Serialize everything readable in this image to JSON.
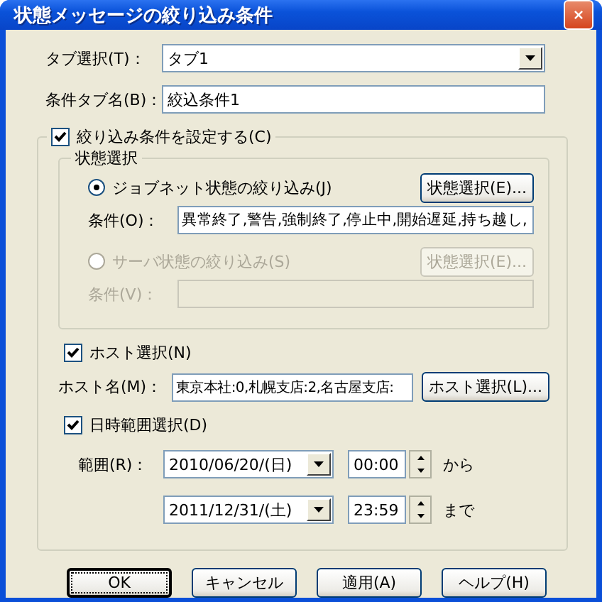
{
  "window": {
    "title": "状態メッセージの絞り込み条件"
  },
  "tab_select": {
    "label": "タブ選択(T)：",
    "value": "タブ1"
  },
  "condition_tab_name": {
    "label": "条件タブ名(B)：",
    "value": "絞込条件1"
  },
  "filter": {
    "label": "絞り込み条件を設定する(C)",
    "checked": true,
    "status_group": {
      "title": "状態選択",
      "options": [
        {
          "label": "ジョブネット状態の絞り込み(J)",
          "selected": true,
          "disabled": false,
          "button": "状態選択(E)...",
          "condition_label": "条件(O)：",
          "condition_value": "異常終了,警告,強制終了,停止中,開始遅延,持ち越し,"
        },
        {
          "label": "サーバ状態の絞り込み(S)",
          "selected": false,
          "disabled": true,
          "button": "状態選択(E)...",
          "condition_label": "条件(V)："
        }
      ]
    },
    "host": {
      "label": "ホスト選択(N)",
      "checked": true,
      "name_label": "ホスト名(M)：",
      "value": "東京本社:0,札幌支店:2,名古屋支店:",
      "button": "ホスト選択(L)..."
    },
    "date_range": {
      "label": "日時範囲選択(D)",
      "checked": true,
      "range_label": "範囲(R)：",
      "rows": [
        {
          "date": "2010/06/20/(日)",
          "time": "00:00",
          "suffix": "から"
        },
        {
          "date": "2011/12/31/(土)",
          "time": "23:59",
          "suffix": "まで"
        }
      ]
    }
  },
  "buttons": [
    {
      "label": "OK",
      "focused": true
    },
    {
      "label": "キャンセル",
      "focused": false
    },
    {
      "label": "適用(A)",
      "focused": false
    },
    {
      "label": "ヘルプ(H)",
      "focused": false
    }
  ]
}
